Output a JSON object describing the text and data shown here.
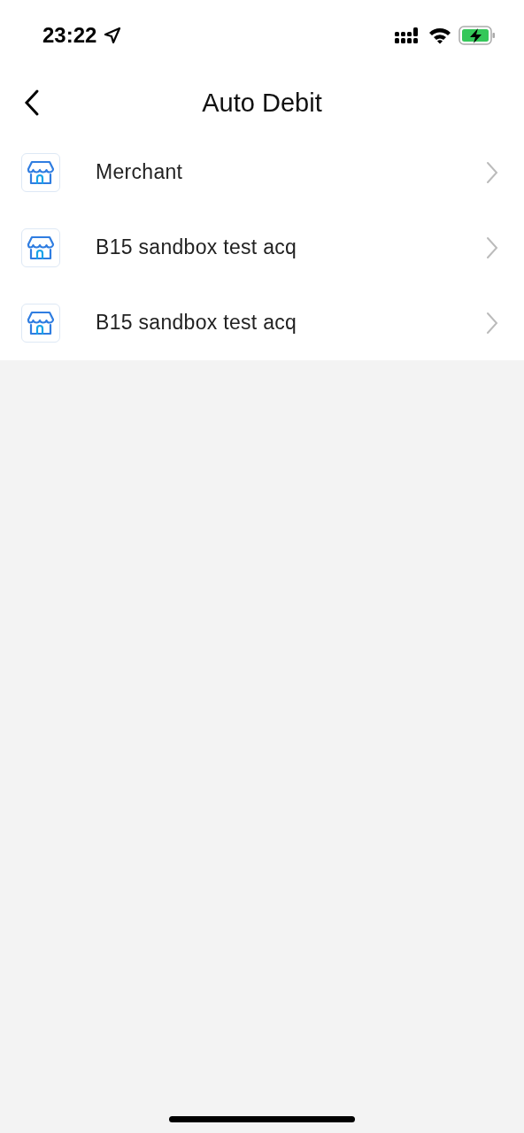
{
  "status_bar": {
    "time": "23:22"
  },
  "header": {
    "title": "Auto Debit"
  },
  "merchants": [
    {
      "name": "Merchant"
    },
    {
      "name": "B15 sandbox test acq"
    },
    {
      "name": "B15 sandbox test acq"
    }
  ]
}
